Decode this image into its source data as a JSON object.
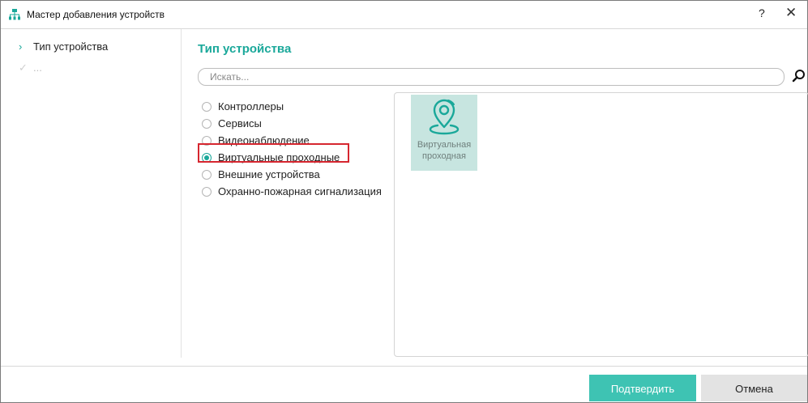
{
  "window": {
    "title": "Мастер добавления устройств",
    "help_label": "?",
    "close_label": "✕"
  },
  "sidebar": {
    "steps": [
      {
        "label": "Тип устройства",
        "glyph": "›",
        "state": "current"
      },
      {
        "label": "...",
        "glyph": "✓",
        "state": "pending"
      }
    ]
  },
  "main": {
    "title": "Тип устройства",
    "search": {
      "placeholder": "Искать...",
      "value": ""
    },
    "device_types": [
      {
        "label": "Контроллеры",
        "selected": false
      },
      {
        "label": "Сервисы",
        "selected": false
      },
      {
        "label": "Видеонаблюдение",
        "selected": false
      },
      {
        "label": "Виртуальные проходные",
        "selected": true
      },
      {
        "label": "Внешние устройства",
        "selected": false
      },
      {
        "label": "Охранно-пожарная сигнализация",
        "selected": false
      }
    ],
    "tiles": [
      {
        "label_line1": "Виртуальная",
        "label_line2": "проходная",
        "icon": "location-pin-icon"
      }
    ]
  },
  "footer": {
    "confirm_label": "Подтвердить",
    "cancel_label": "Отмена"
  },
  "colors": {
    "accent": "#1aa89a",
    "confirm_button": "#3ec3b3",
    "tile_background": "#c7e5e0",
    "highlight": "#d6262f"
  }
}
